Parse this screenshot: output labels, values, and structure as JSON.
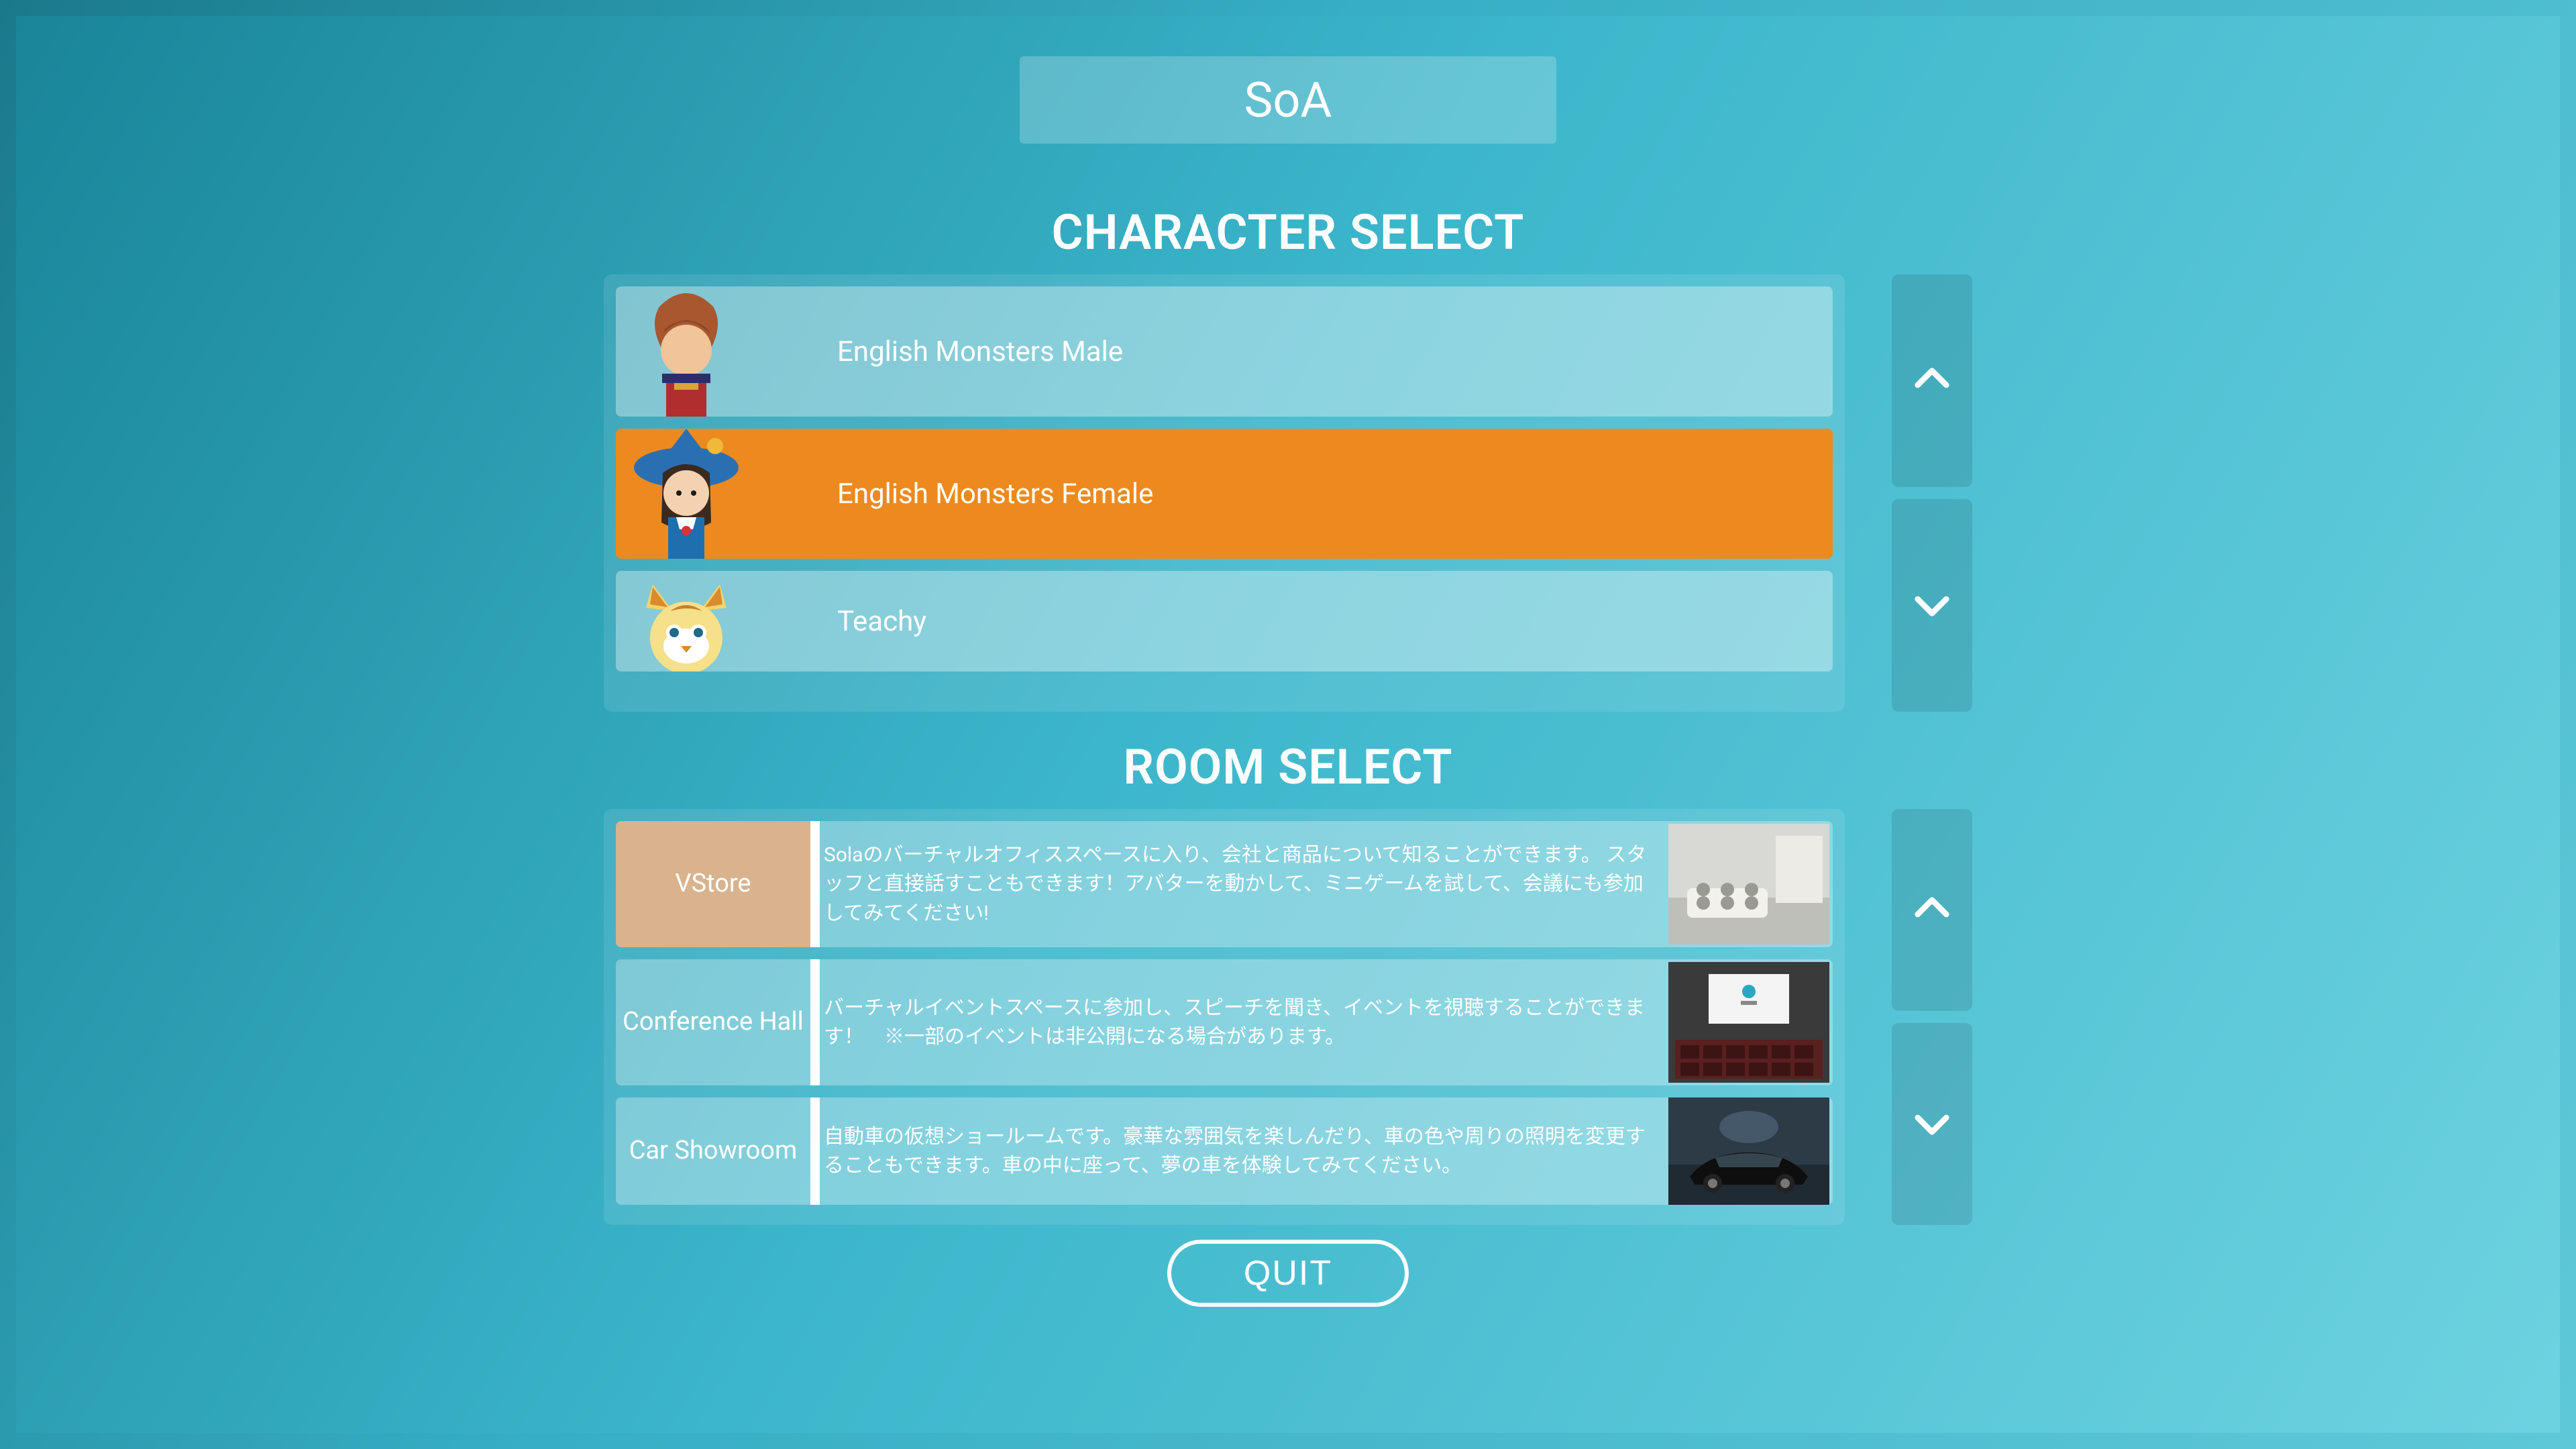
{
  "header": {
    "title": "SoA"
  },
  "sections": {
    "character_title": "CHARACTER SELECT",
    "room_title": "ROOM SELECT"
  },
  "characters": [
    {
      "label": "English Monsters Male",
      "selected": false,
      "avatar": "male"
    },
    {
      "label": "English Monsters Female",
      "selected": true,
      "avatar": "female"
    },
    {
      "label": "Teachy",
      "selected": false,
      "avatar": "teachy"
    }
  ],
  "rooms": [
    {
      "name": "VStore",
      "selected": true,
      "desc": "Solaのバーチャルオフィススペースに入り、会社と商品について知ることができます。 スタッフと直接話すこともできます！アバターを動かして、ミニゲームを試して、会議にも参加してみてください!",
      "thumb": "office"
    },
    {
      "name": "Conference Hall",
      "selected": false,
      "desc": "バーチャルイベントスペースに参加し、スピーチを聞き、イベントを視聴することができます！　※一部のイベントは非公開になる場合があります。",
      "thumb": "hall"
    },
    {
      "name": "Car Showroom",
      "selected": false,
      "desc": "自動車の仮想ショールームです。豪華な雰囲気を楽しんだり、車の色や周りの照明を変更することもできます。車の中に座って、夢の車を体験してみてください。",
      "thumb": "car"
    }
  ],
  "footer": {
    "quit": "QUIT"
  }
}
